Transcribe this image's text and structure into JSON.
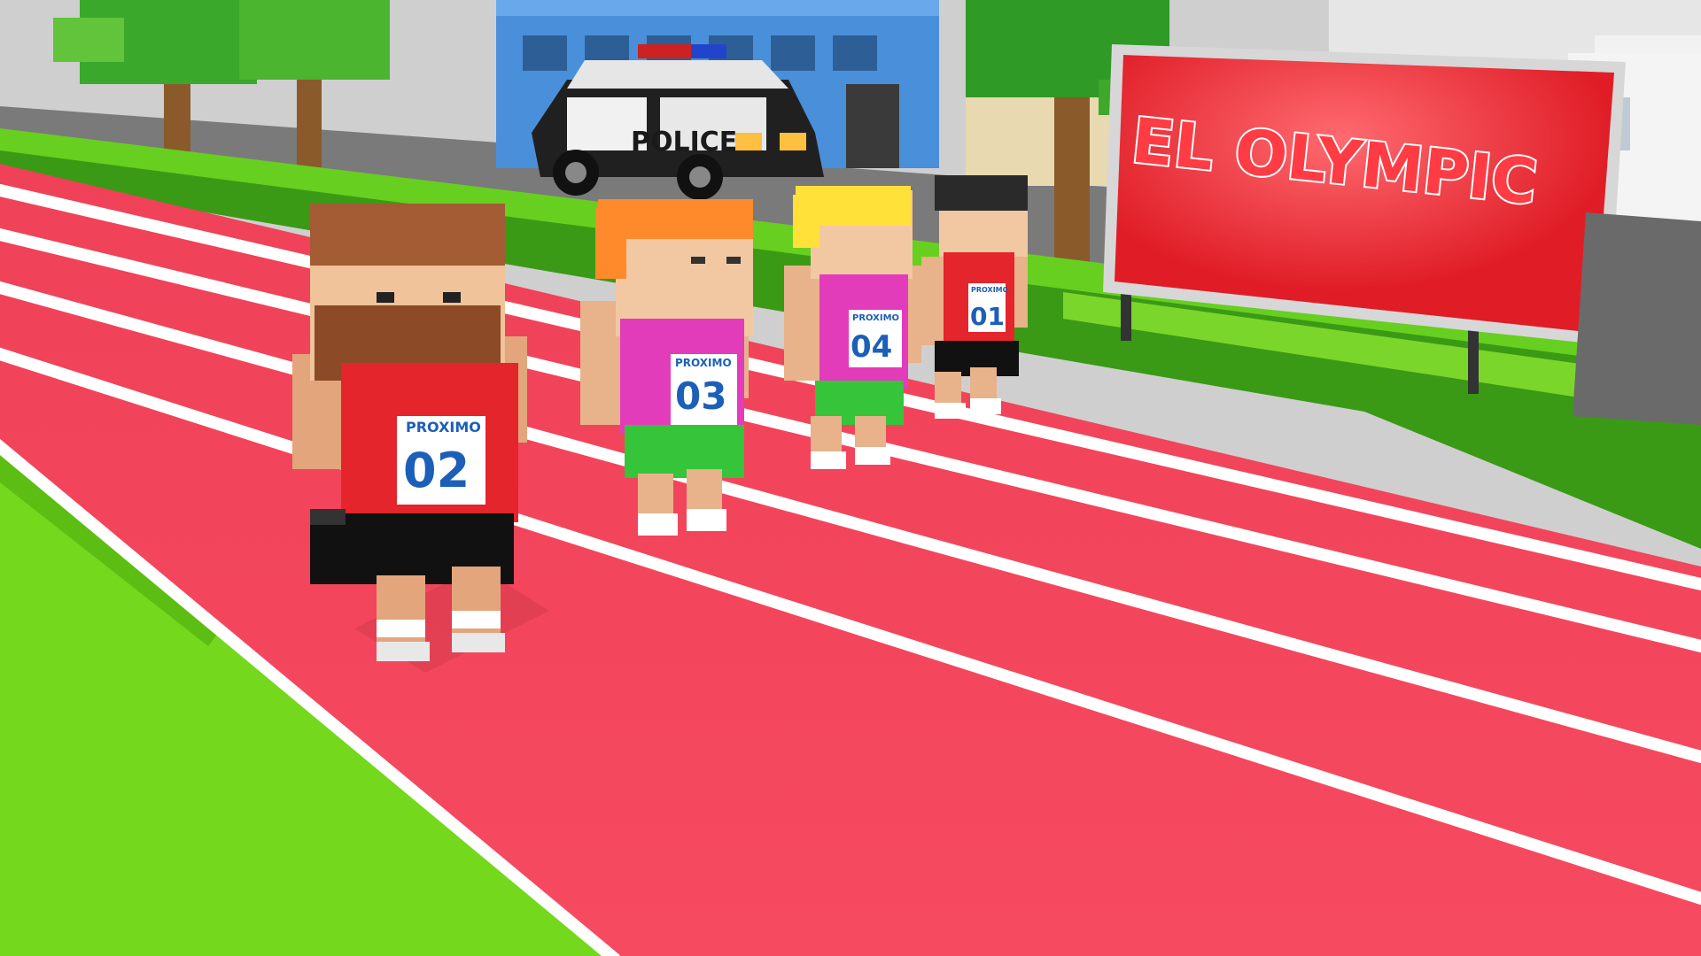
{
  "scene": {
    "billboard": {
      "text": "EL OLYMPIC"
    },
    "police_car": {
      "label": "POLICE"
    },
    "runners": [
      {
        "bib_brand": "PROXIMO",
        "bib_number": "02"
      },
      {
        "bib_brand": "PROXIMO",
        "bib_number": "03"
      },
      {
        "bib_brand": "PROXIMO",
        "bib_number": "04"
      },
      {
        "bib_brand": "PROXIMO",
        "bib_number": "01"
      }
    ]
  },
  "colors": {
    "track": "#f2475d",
    "grass": "#72d81c",
    "hedge": "#3e9f16",
    "sign": "#e8212b",
    "bib_text": "#1c5fb8"
  }
}
